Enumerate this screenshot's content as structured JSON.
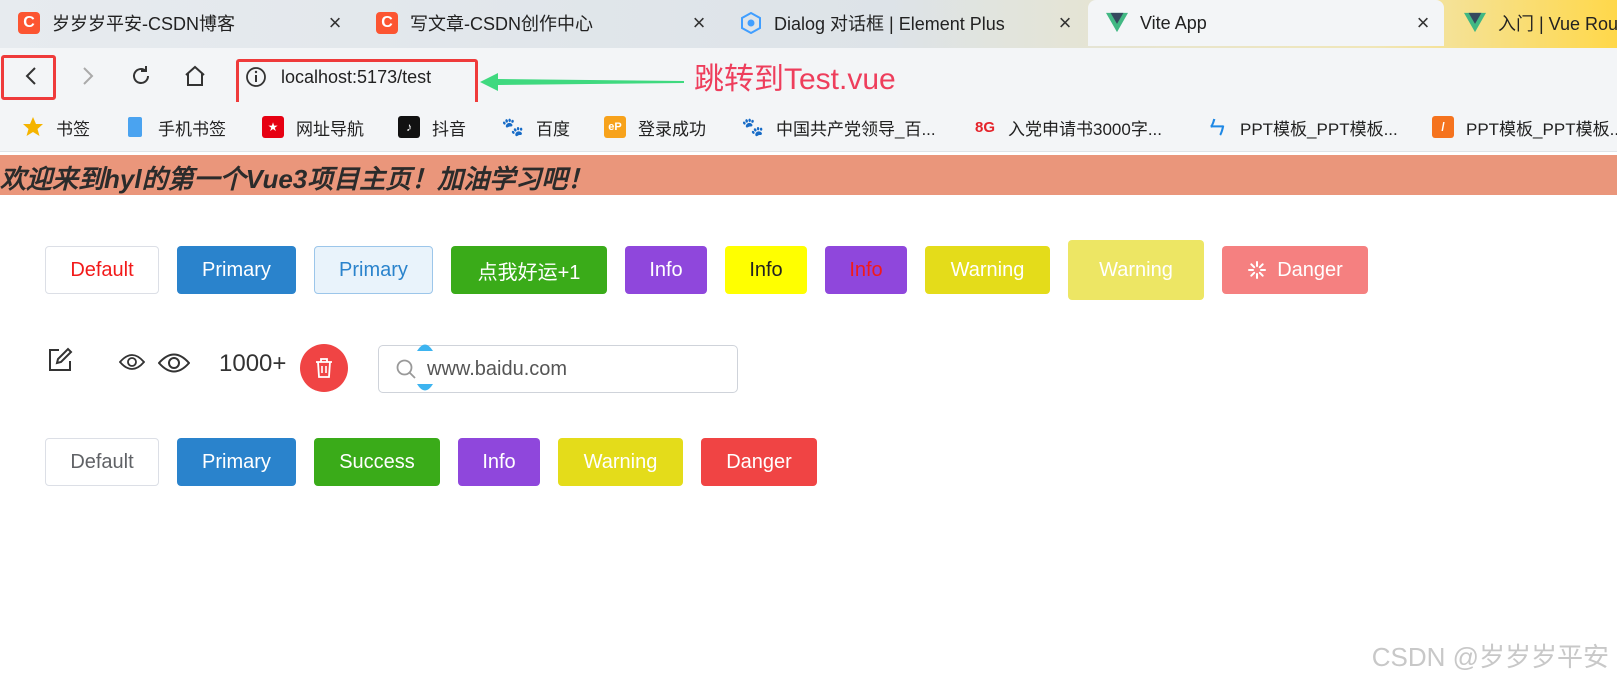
{
  "browser": {
    "tabs": [
      {
        "title": "岁岁岁平安-CSDN博客",
        "icon": "csdn-icon"
      },
      {
        "title": "写文章-CSDN创作中心",
        "icon": "csdn-icon"
      },
      {
        "title": "Dialog 对话框 | Element Plus",
        "icon": "element-plus-icon"
      },
      {
        "title": "Vite App",
        "icon": "vue-icon",
        "active": true
      },
      {
        "title": "入门 | Vue Rout",
        "icon": "vue-icon"
      }
    ],
    "url": "localhost:5173/test",
    "annotation": "跳转到Test.vue",
    "bookmarks": [
      {
        "label": "书签",
        "icon": "star-icon",
        "color": "#f5b400"
      },
      {
        "label": "手机书签",
        "icon": "phone-icon",
        "color": "#4aa3f0"
      },
      {
        "label": "网址导航",
        "icon": "nav-site-icon",
        "color": "#e60012"
      },
      {
        "label": "抖音",
        "icon": "tiktok-icon",
        "color": "#111111"
      },
      {
        "label": "百度",
        "icon": "baidu-icon",
        "color": "#2932e1"
      },
      {
        "label": "登录成功",
        "icon": "ep-icon",
        "color": "#f7a21b"
      },
      {
        "label": "中国共产党领导_百...",
        "icon": "baidu-icon",
        "color": "#2932e1"
      },
      {
        "label": "入党申请书3000字...",
        "icon": "8g-icon",
        "color": "#e5242b"
      },
      {
        "label": "PPT模板_PPT模板...",
        "icon": "ppt-icon",
        "color": "#1e88e5"
      },
      {
        "label": "PPT模板_PPT模板...",
        "icon": "ppt-orange-icon",
        "color": "#f5731e"
      }
    ]
  },
  "page": {
    "banner": "欢迎来到hyl的第一个Vue3项目主页！加油学习吧！",
    "row1": [
      {
        "label": "Default"
      },
      {
        "label": "Primary"
      },
      {
        "label": "Primary"
      },
      {
        "label": "点我好运+1"
      },
      {
        "label": "Info"
      },
      {
        "label": "Info"
      },
      {
        "label": "Info"
      },
      {
        "label": "Warning"
      },
      {
        "label": "Warning"
      },
      {
        "label": "Danger"
      }
    ],
    "badge": "1000+",
    "search": {
      "value": "www.baidu.com"
    },
    "row3": [
      {
        "label": "Default"
      },
      {
        "label": "Primary"
      },
      {
        "label": "Success"
      },
      {
        "label": "Info"
      },
      {
        "label": "Warning"
      },
      {
        "label": "Danger"
      }
    ],
    "watermark": "CSDN @岁岁岁平安"
  },
  "colors": {
    "primary": "#2a83cc",
    "success": "#3aab19",
    "info": "#8f47dc",
    "warning": "#e4dc1a",
    "danger": "#f04444",
    "banner": "#ea967b",
    "highlight": "#ef3b3b",
    "annotation": "#ee3e5c"
  }
}
